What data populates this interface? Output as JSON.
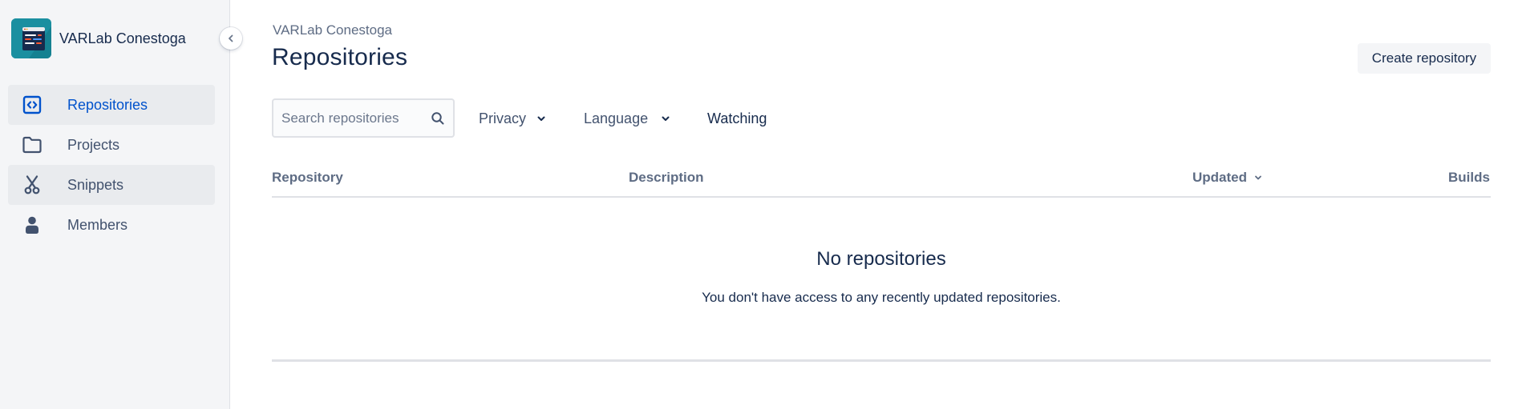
{
  "workspace": {
    "name": "VARLab Conestoga",
    "avatar_color": "#1b8fa0"
  },
  "sidebar": {
    "collapse_icon": "chevron-left-icon",
    "items": [
      {
        "label": "Repositories",
        "icon": "code-brackets-icon",
        "active": true
      },
      {
        "label": "Projects",
        "icon": "folder-icon",
        "active": false
      },
      {
        "label": "Snippets",
        "icon": "scissors-icon",
        "active": false
      },
      {
        "label": "Members",
        "icon": "person-icon",
        "active": false
      }
    ]
  },
  "header": {
    "breadcrumb": "VARLab Conestoga",
    "title": "Repositories",
    "create_button": "Create repository"
  },
  "filters": {
    "search_placeholder": "Search repositories",
    "search_value": "",
    "privacy_label": "Privacy",
    "language_label": "Language",
    "watching_label": "Watching"
  },
  "table": {
    "columns": [
      "Repository",
      "Description",
      "Updated",
      "Builds"
    ],
    "sort_column": "Updated"
  },
  "empty_state": {
    "title": "No repositories",
    "description": "You don't have access to any recently updated repositories."
  },
  "colors": {
    "accent": "#0052cc",
    "sidebar_bg": "#f4f5f7",
    "text_primary": "#172b4d",
    "text_secondary": "#42526e"
  }
}
